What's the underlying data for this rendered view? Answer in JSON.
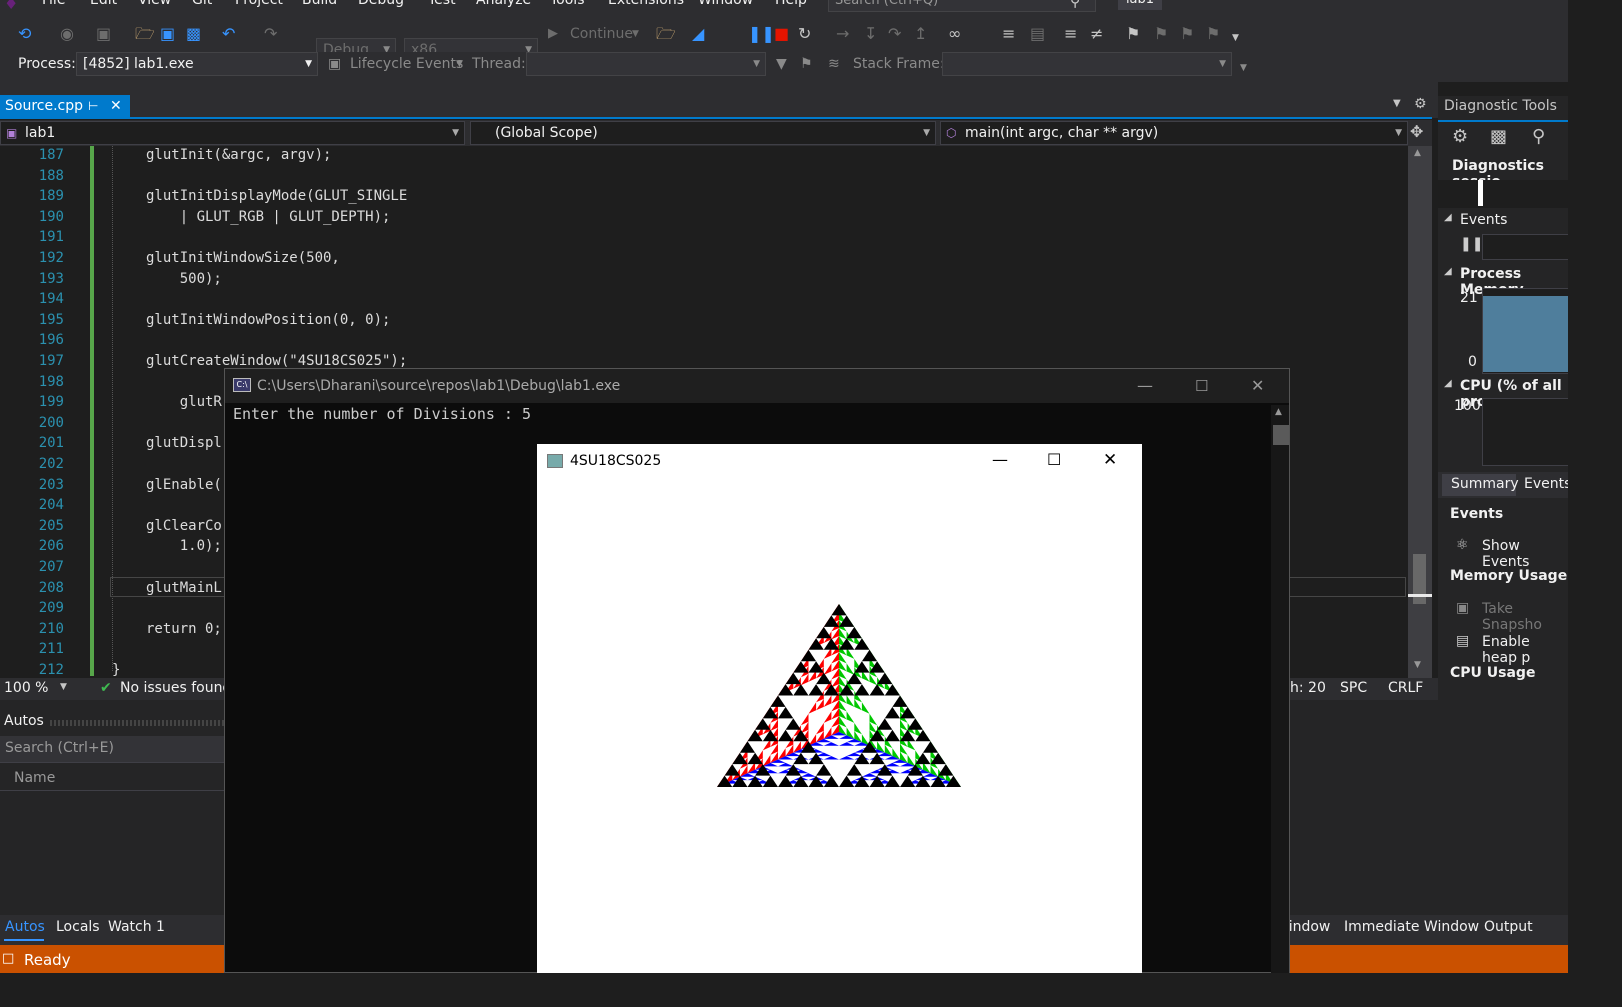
{
  "menu": {
    "items": [
      "File",
      "Edit",
      "View",
      "Git",
      "Project",
      "Build",
      "Debug",
      "Test",
      "Analyze",
      "Tools",
      "Extensions",
      "Window",
      "Help"
    ],
    "search_placeholder": "Search (Ctrl+Q)",
    "solution": "lab1"
  },
  "toolbar": {
    "config": "Debug",
    "platform": "x86",
    "continue_label": "Continue"
  },
  "toolbar2": {
    "process_label": "Process:",
    "process_value": "[4852] lab1.exe",
    "lifecycle_label": "Lifecycle Events",
    "thread_label": "Thread:",
    "stackframe_label": "Stack Frame:"
  },
  "editor": {
    "tab": "Source.cpp",
    "nav": {
      "project": "lab1",
      "scope": "(Global Scope)",
      "member": "main(int argc, char ** argv)"
    },
    "lines": [
      {
        "n": "187",
        "code": "glutInit(&argc, argv);"
      },
      {
        "n": "188",
        "code": ""
      },
      {
        "n": "189",
        "code": "glutInitDisplayMode(GLUT_SINGLE"
      },
      {
        "n": "190",
        "code": "    | GLUT_RGB | GLUT_DEPTH);"
      },
      {
        "n": "191",
        "code": ""
      },
      {
        "n": "192",
        "code": "glutInitWindowSize(500,"
      },
      {
        "n": "193",
        "code": "    500);"
      },
      {
        "n": "194",
        "code": ""
      },
      {
        "n": "195",
        "code": "glutInitWindowPosition(0, 0);"
      },
      {
        "n": "196",
        "code": ""
      },
      {
        "n": "197",
        "code": "glutCreateWindow(\"4SU18CS025\");"
      },
      {
        "n": "198",
        "code": ""
      },
      {
        "n": "199",
        "code": "    glutR"
      },
      {
        "n": "200",
        "code": ""
      },
      {
        "n": "201",
        "code": "glutDispl"
      },
      {
        "n": "202",
        "code": ""
      },
      {
        "n": "203",
        "code": "glEnable("
      },
      {
        "n": "204",
        "code": ""
      },
      {
        "n": "205",
        "code": "glClearCo"
      },
      {
        "n": "206",
        "code": "    1.0);"
      },
      {
        "n": "207",
        "code": ""
      },
      {
        "n": "208",
        "code": "glutMainL"
      },
      {
        "n": "209",
        "code": ""
      },
      {
        "n": "210",
        "code": "return 0;"
      },
      {
        "n": "211",
        "code": ""
      },
      {
        "n": "212",
        "code": "}"
      }
    ],
    "zoom": "100 %",
    "issues": "No issues found",
    "cursor": "h: 20",
    "spc": "SPC",
    "eol": "CRLF"
  },
  "autos": {
    "title": "Autos",
    "search_placeholder": "Search (Ctrl+E)",
    "col_name": "Name"
  },
  "bottom_tabs": [
    "Autos",
    "Locals",
    "Watch 1"
  ],
  "bottom_tabs_right": [
    "/indow",
    "Immediate Window",
    "Output"
  ],
  "status": {
    "text": "Ready"
  },
  "diag": {
    "title": "Diagnostic Tools",
    "sessions": "Diagnostics sessio",
    "events": "Events",
    "process_memory": "Process Memory",
    "mem_max": "21",
    "mem_min": "0",
    "cpu": "CPU (% of all pro",
    "cpu_max": "100",
    "tabs": [
      "Summary",
      "Events"
    ],
    "sec_events": "Events",
    "show_events": "Show Events",
    "sec_memory": "Memory Usage",
    "take_snapshot": "Take Snapsho",
    "enable_heap": "Enable heap p",
    "sec_cpu": "CPU Usage"
  },
  "console": {
    "title": "C:\\Users\\Dharani\\source\\repos\\lab1\\Debug\\lab1.exe",
    "text": "Enter the number of Divisions : 5"
  },
  "glut": {
    "title": "4SU18CS025",
    "colors": {
      "red": "#ff0000",
      "green": "#00c800",
      "blue": "#0000ff",
      "black": "#000000"
    }
  }
}
